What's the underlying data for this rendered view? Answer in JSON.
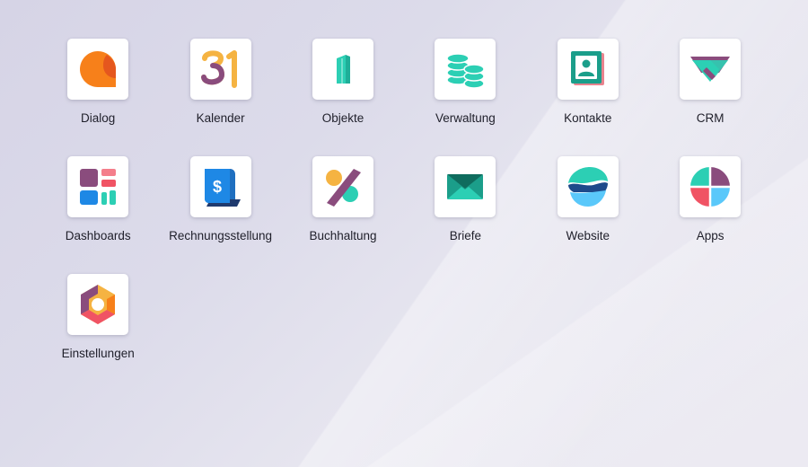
{
  "apps": [
    {
      "label": "Dialog",
      "icon": "chat-bubble-icon"
    },
    {
      "label": "Kalender",
      "icon": "calendar-31-icon"
    },
    {
      "label": "Objekte",
      "icon": "door-icon"
    },
    {
      "label": "Verwaltung",
      "icon": "coin-stacks-icon"
    },
    {
      "label": "Kontakte",
      "icon": "contact-card-icon"
    },
    {
      "label": "CRM",
      "icon": "handshake-icon"
    },
    {
      "label": "Dashboards",
      "icon": "dashboard-tiles-icon"
    },
    {
      "label": "Rechnungsstellung",
      "icon": "invoice-dollar-icon"
    },
    {
      "label": "Buchhaltung",
      "icon": "percent-icon"
    },
    {
      "label": "Briefe",
      "icon": "envelope-icon"
    },
    {
      "label": "Website",
      "icon": "globe-waves-icon"
    },
    {
      "label": "Apps",
      "icon": "apps-drop-icon"
    },
    {
      "label": "Einstellungen",
      "icon": "settings-hexagon-icon"
    }
  ],
  "colors": {
    "orange": "#f7801a",
    "teal": "#2ccfb4",
    "purple": "#8a4c7d",
    "red": "#f05364",
    "blue": "#1e88e5",
    "yellow": "#f5b342"
  }
}
